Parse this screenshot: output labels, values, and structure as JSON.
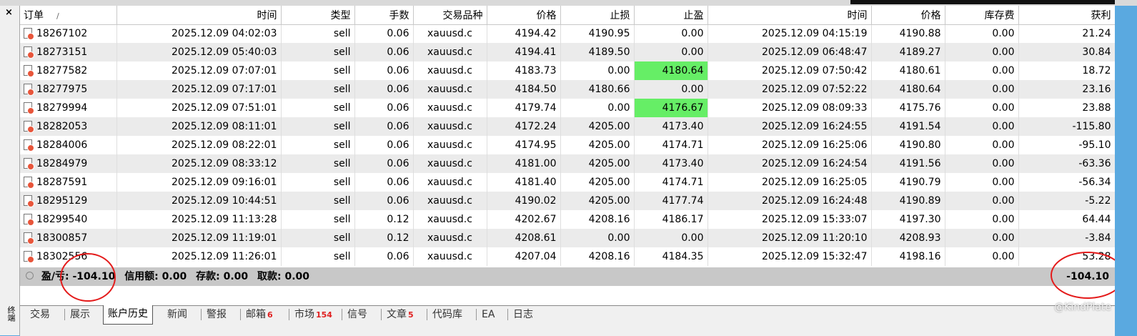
{
  "window": {
    "close_glyph": "×",
    "side_label": "终端"
  },
  "columns": [
    "订单",
    "时间",
    "类型",
    "手数",
    "交易品种",
    "价格",
    "止损",
    "止盈",
    "时间",
    "价格",
    "库存费",
    "获利"
  ],
  "sort_indicator": "/",
  "rows": [
    {
      "order": "18267102",
      "open_time": "2025.12.09 04:02:03",
      "type": "sell",
      "lots": "0.06",
      "symbol": "xauusd.c",
      "open_price": "4194.42",
      "sl": "4190.95",
      "tp": "0.00",
      "close_time": "2025.12.09 04:15:19",
      "close_price": "4190.88",
      "swap": "0.00",
      "profit": "21.24"
    },
    {
      "order": "18273151",
      "open_time": "2025.12.09 05:40:03",
      "type": "sell",
      "lots": "0.06",
      "symbol": "xauusd.c",
      "open_price": "4194.41",
      "sl": "4189.50",
      "tp": "0.00",
      "close_time": "2025.12.09 06:48:47",
      "close_price": "4189.27",
      "swap": "0.00",
      "profit": "30.84"
    },
    {
      "order": "18277582",
      "open_time": "2025.12.09 07:07:01",
      "type": "sell",
      "lots": "0.06",
      "symbol": "xauusd.c",
      "open_price": "4183.73",
      "sl": "0.00",
      "tp": "4180.64",
      "close_time": "2025.12.09 07:50:42",
      "close_price": "4180.61",
      "swap": "0.00",
      "profit": "18.72",
      "tp_hit": true
    },
    {
      "order": "18277975",
      "open_time": "2025.12.09 07:17:01",
      "type": "sell",
      "lots": "0.06",
      "symbol": "xauusd.c",
      "open_price": "4184.50",
      "sl": "4180.66",
      "tp": "0.00",
      "close_time": "2025.12.09 07:52:22",
      "close_price": "4180.64",
      "swap": "0.00",
      "profit": "23.16"
    },
    {
      "order": "18279994",
      "open_time": "2025.12.09 07:51:01",
      "type": "sell",
      "lots": "0.06",
      "symbol": "xauusd.c",
      "open_price": "4179.74",
      "sl": "0.00",
      "tp": "4176.67",
      "close_time": "2025.12.09 08:09:33",
      "close_price": "4175.76",
      "swap": "0.00",
      "profit": "23.88",
      "tp_hit": true
    },
    {
      "order": "18282053",
      "open_time": "2025.12.09 08:11:01",
      "type": "sell",
      "lots": "0.06",
      "symbol": "xauusd.c",
      "open_price": "4172.24",
      "sl": "4205.00",
      "tp": "4173.40",
      "close_time": "2025.12.09 16:24:55",
      "close_price": "4191.54",
      "swap": "0.00",
      "profit": "-115.80"
    },
    {
      "order": "18284006",
      "open_time": "2025.12.09 08:22:01",
      "type": "sell",
      "lots": "0.06",
      "symbol": "xauusd.c",
      "open_price": "4174.95",
      "sl": "4205.00",
      "tp": "4174.71",
      "close_time": "2025.12.09 16:25:06",
      "close_price": "4190.80",
      "swap": "0.00",
      "profit": "-95.10"
    },
    {
      "order": "18284979",
      "open_time": "2025.12.09 08:33:12",
      "type": "sell",
      "lots": "0.06",
      "symbol": "xauusd.c",
      "open_price": "4181.00",
      "sl": "4205.00",
      "tp": "4173.40",
      "close_time": "2025.12.09 16:24:54",
      "close_price": "4191.56",
      "swap": "0.00",
      "profit": "-63.36"
    },
    {
      "order": "18287591",
      "open_time": "2025.12.09 09:16:01",
      "type": "sell",
      "lots": "0.06",
      "symbol": "xauusd.c",
      "open_price": "4181.40",
      "sl": "4205.00",
      "tp": "4174.71",
      "close_time": "2025.12.09 16:25:05",
      "close_price": "4190.79",
      "swap": "0.00",
      "profit": "-56.34"
    },
    {
      "order": "18295129",
      "open_time": "2025.12.09 10:44:51",
      "type": "sell",
      "lots": "0.06",
      "symbol": "xauusd.c",
      "open_price": "4190.02",
      "sl": "4205.00",
      "tp": "4177.74",
      "close_time": "2025.12.09 16:24:48",
      "close_price": "4190.89",
      "swap": "0.00",
      "profit": "-5.22"
    },
    {
      "order": "18299540",
      "open_time": "2025.12.09 11:13:28",
      "type": "sell",
      "lots": "0.12",
      "symbol": "xauusd.c",
      "open_price": "4202.67",
      "sl": "4208.16",
      "tp": "4186.17",
      "close_time": "2025.12.09 15:33:07",
      "close_price": "4197.30",
      "swap": "0.00",
      "profit": "64.44"
    },
    {
      "order": "18300857",
      "open_time": "2025.12.09 11:19:01",
      "type": "sell",
      "lots": "0.12",
      "symbol": "xauusd.c",
      "open_price": "4208.61",
      "sl": "0.00",
      "tp": "0.00",
      "close_time": "2025.12.09 11:20:10",
      "close_price": "4208.93",
      "swap": "0.00",
      "profit": "-3.84"
    },
    {
      "order": "18302556",
      "open_time": "2025.12.09 11:26:01",
      "type": "sell",
      "lots": "0.06",
      "symbol": "xauusd.c",
      "open_price": "4207.04",
      "sl": "4208.16",
      "tp": "4184.35",
      "close_time": "2025.12.09 15:32:47",
      "close_price": "4198.16",
      "swap": "0.00",
      "profit": "53.28"
    }
  ],
  "summary": {
    "pl_label": "盈/亏:",
    "pl_value": "-104.10",
    "credit_label": "信用额:",
    "credit_value": "0.00",
    "deposit_label": "存款:",
    "deposit_value": "0.00",
    "withdraw_label": "取款:",
    "withdraw_value": "0.00",
    "total_profit": "-104.10"
  },
  "tabs": [
    {
      "label": "交易"
    },
    {
      "label": "展示"
    },
    {
      "label": "账户历史",
      "active": true
    },
    {
      "label": "新闻"
    },
    {
      "label": "警报"
    },
    {
      "label": "邮箱",
      "badge": "6"
    },
    {
      "label": "市场",
      "badge": "154"
    },
    {
      "label": "信号"
    },
    {
      "label": "文章",
      "badge": "5"
    },
    {
      "label": "代码库"
    },
    {
      "label": "EA"
    },
    {
      "label": "日志"
    }
  ],
  "watermark": "@KindPlate",
  "colors": {
    "tp_hit": "#66ee66",
    "highlight_ring": "#e41b1b",
    "summary_bg": "#c8c8c8",
    "badge": "#e02020"
  }
}
